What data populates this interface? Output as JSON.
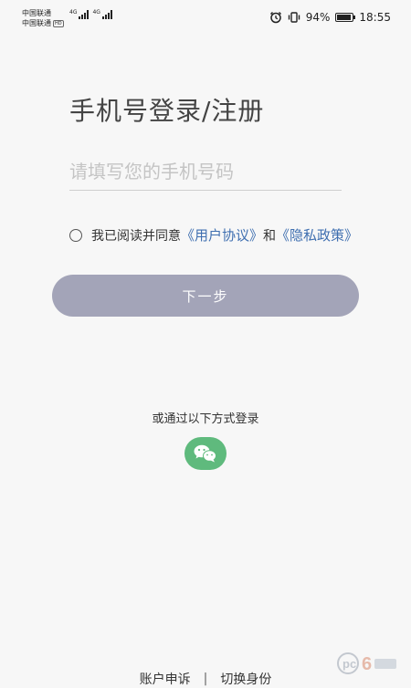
{
  "status_bar": {
    "carrier_1": "中国联通",
    "carrier_2": "中国联通",
    "hd_badge": "HD",
    "network_1": "4G",
    "network_2": "4G",
    "battery_percent": "94%",
    "battery_level": 0.94,
    "time": "18:55"
  },
  "login": {
    "title": "手机号登录/注册",
    "phone_placeholder": "请填写您的手机号码",
    "phone_value": ""
  },
  "agreement": {
    "prefix": "我已阅读并同意",
    "user_agreement": "《用户协议》",
    "conjunction": "和",
    "privacy_policy": "《隐私政策》",
    "checked": false
  },
  "next_button": {
    "label": "下一步",
    "color": "#a3a4b8"
  },
  "alt_login": {
    "text": "或通过以下方式登录",
    "wechat_icon": "wechat-icon",
    "wechat_color": "#5fba7d"
  },
  "footer": {
    "appeal": "账户申诉",
    "separator": "|",
    "switch_identity": "切换身份"
  },
  "watermark": "pc6"
}
